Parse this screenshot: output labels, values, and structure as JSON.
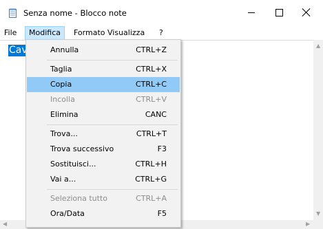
{
  "window": {
    "title": "Senza nome - Blocco note"
  },
  "menubar": {
    "file": "File",
    "modifica": "Modifica",
    "formato": "Formato",
    "visualizza": "Visualizza",
    "help": "?"
  },
  "editor": {
    "selected_text": "Cavallo"
  },
  "dropdown": {
    "items": [
      {
        "label": "Annulla",
        "shortcut": "CTRL+Z",
        "enabled": true
      },
      {
        "label": "Taglia",
        "shortcut": "CTRL+X",
        "enabled": true
      },
      {
        "label": "Copia",
        "shortcut": "CTRL+C",
        "enabled": true,
        "highlighted": true
      },
      {
        "label": "Incolla",
        "shortcut": "CTRL+V",
        "enabled": false
      },
      {
        "label": "Elimina",
        "shortcut": "CANC",
        "enabled": true
      },
      {
        "label": "Trova...",
        "shortcut": "CTRL+T",
        "enabled": true
      },
      {
        "label": "Trova successivo",
        "shortcut": "F3",
        "enabled": true
      },
      {
        "label": "Sostituisci...",
        "shortcut": "CTRL+H",
        "enabled": true
      },
      {
        "label": "Vai a...",
        "shortcut": "CTRL+G",
        "enabled": true
      },
      {
        "label": "Seleziona tutto",
        "shortcut": "CTRL+A",
        "enabled": false
      },
      {
        "label": "Ora/Data",
        "shortcut": "F5",
        "enabled": true
      }
    ]
  },
  "colors": {
    "selection": "#0078d7",
    "menu_highlight": "#91c9f7",
    "menu_active": "#cce8ff",
    "disabled_text": "#8c8c8c"
  },
  "icons": {
    "app": "notepad-icon",
    "minimize": "minimize-icon",
    "maximize": "maximize-icon",
    "close": "close-icon"
  }
}
